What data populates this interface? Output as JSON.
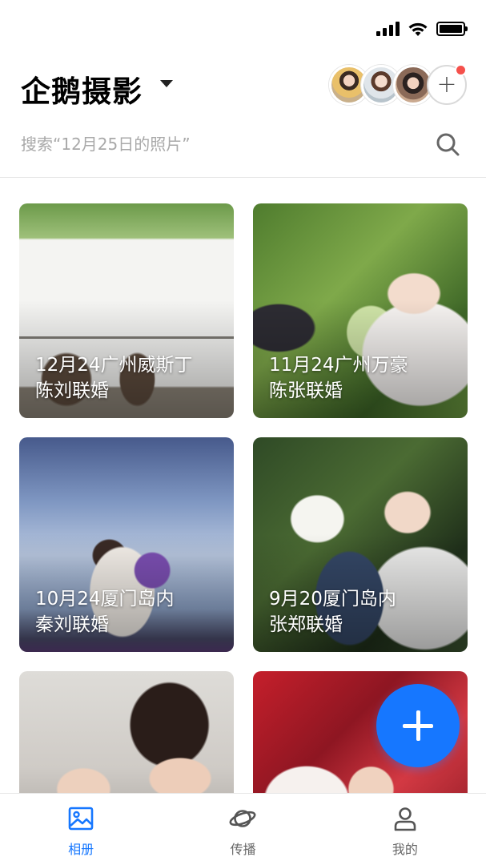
{
  "status_bar": {
    "icons": [
      "signal-icon",
      "wifi-icon",
      "battery-icon"
    ]
  },
  "header": {
    "title": "企鹅摄影",
    "avatars": [
      "avatar-1",
      "avatar-2",
      "avatar-3"
    ],
    "add_member_label": "+"
  },
  "search": {
    "placeholder": "搜索“12月25日的照片”"
  },
  "albums": [
    {
      "line1": "12月24广州威斯丁",
      "line2": "陈刘联婚"
    },
    {
      "line1": "11月24广州万豪",
      "line2": "陈张联婚"
    },
    {
      "line1": "10月24厦门岛内",
      "line2": "秦刘联婚"
    },
    {
      "line1": "9月20厦门岛内",
      "line2": "张郑联婚"
    },
    {
      "line1": "",
      "line2": ""
    },
    {
      "line1": "",
      "line2": ""
    }
  ],
  "tabs": [
    {
      "label": "相册",
      "icon": "image-icon",
      "active": true
    },
    {
      "label": "传播",
      "icon": "planet-icon",
      "active": false
    },
    {
      "label": "我的",
      "icon": "person-icon",
      "active": false
    }
  ],
  "colors": {
    "accent": "#1677ff",
    "badge": "#f5504b"
  }
}
